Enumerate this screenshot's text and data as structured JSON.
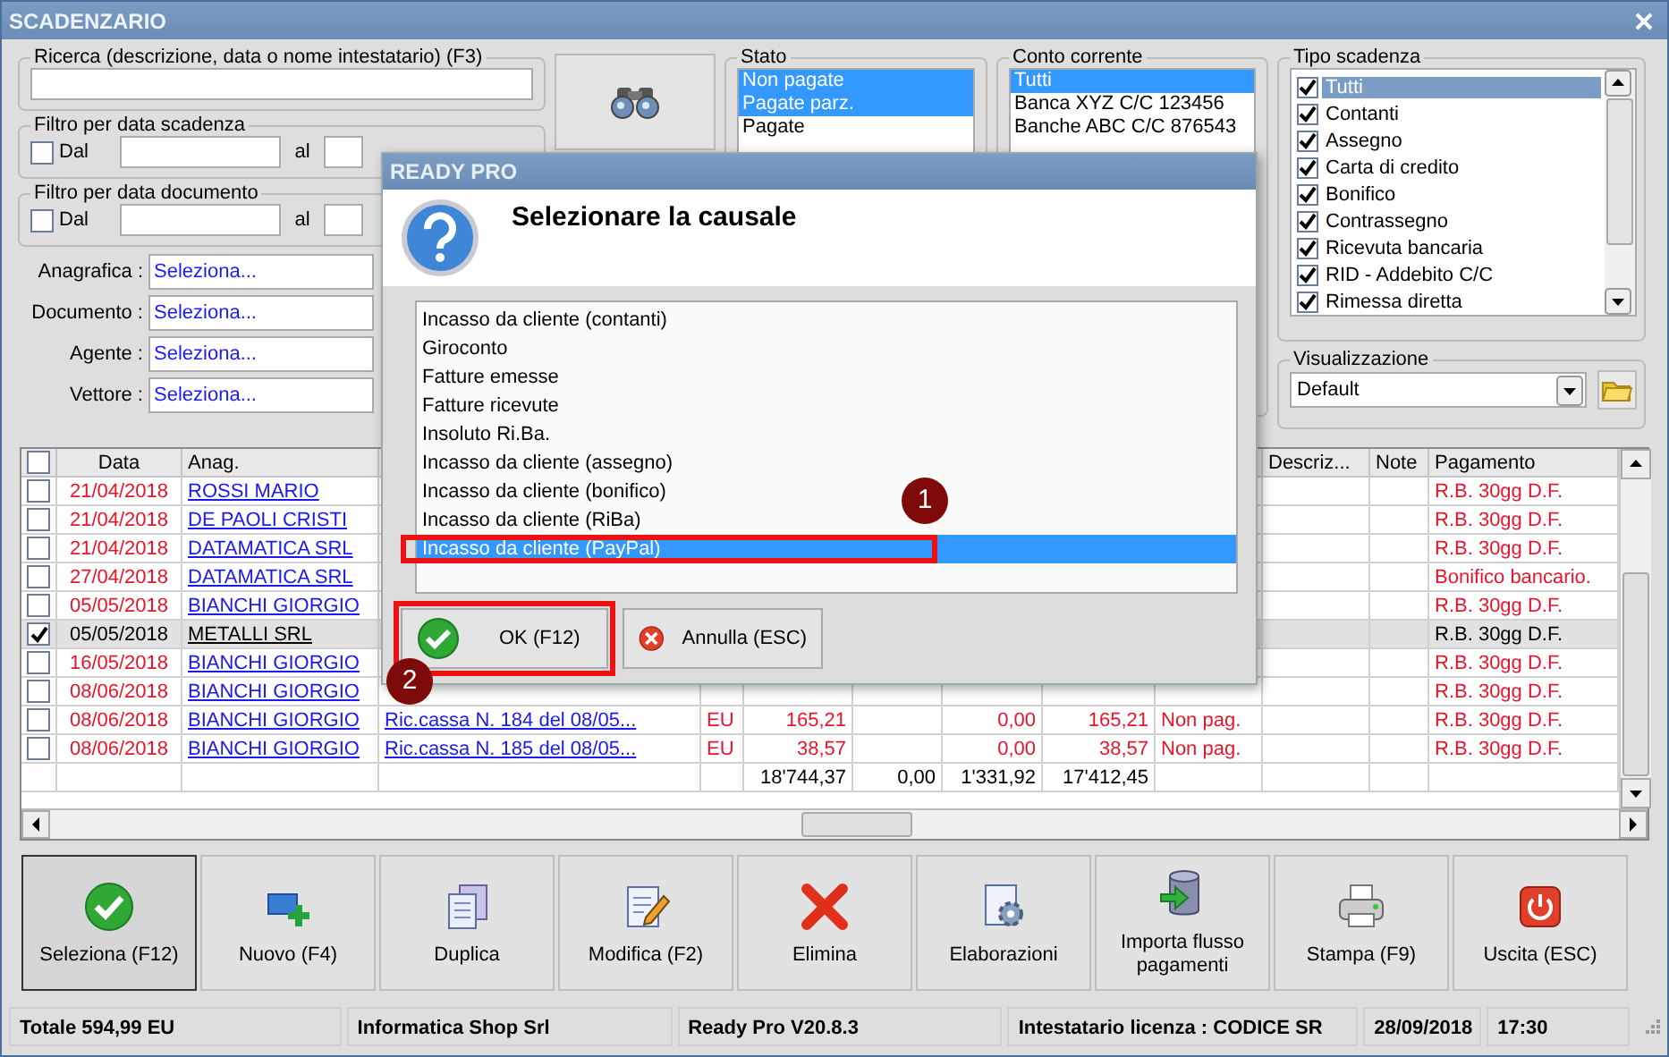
{
  "window": {
    "title": "SCADENZARIO"
  },
  "search": {
    "label": "Ricerca (descrizione, data o nome intestatario) (F3)"
  },
  "date_filters": [
    {
      "label": "Filtro per data scadenza",
      "from_label": "Dal",
      "to_label": "al",
      "checked": false
    },
    {
      "label": "Filtro per data documento",
      "from_label": "Dal",
      "to_label": "al",
      "checked": false
    }
  ],
  "lookups": [
    {
      "label": "Anagrafica :",
      "value": "Seleziona..."
    },
    {
      "label": "Documento :",
      "value": "Seleziona..."
    },
    {
      "label": "Agente :",
      "value": "Seleziona..."
    },
    {
      "label": "Vettore :",
      "value": "Seleziona..."
    }
  ],
  "stato": {
    "label": "Stato",
    "items": [
      {
        "label": "Non pagate",
        "selected": true
      },
      {
        "label": "Pagate parz.",
        "selected": true
      },
      {
        "label": "Pagate",
        "selected": false
      }
    ]
  },
  "conto": {
    "label": "Conto corrente",
    "items": [
      {
        "label": "Tutti",
        "selected": true
      },
      {
        "label": "Banca XYZ C/C 123456",
        "selected": false
      },
      {
        "label": "Banche ABC C/C 876543",
        "selected": false
      }
    ]
  },
  "tipo": {
    "label": "Tipo scadenza",
    "items": [
      {
        "label": "Tutti",
        "checked": true,
        "selected": true
      },
      {
        "label": "Contanti",
        "checked": true,
        "selected": false
      },
      {
        "label": "Assegno",
        "checked": true,
        "selected": false
      },
      {
        "label": "Carta di credito",
        "checked": true,
        "selected": false
      },
      {
        "label": "Bonifico",
        "checked": true,
        "selected": false
      },
      {
        "label": "Contrassegno",
        "checked": true,
        "selected": false
      },
      {
        "label": "Ricevuta bancaria",
        "checked": true,
        "selected": false
      },
      {
        "label": "RID - Addebito C/C",
        "checked": true,
        "selected": false
      },
      {
        "label": "Rimessa diretta",
        "checked": true,
        "selected": false
      }
    ]
  },
  "view": {
    "label": "Visualizzazione",
    "value": "Default"
  },
  "table": {
    "header_checked": false,
    "headers": {
      "date": "Data",
      "name": "Anag.",
      "description": "Descriz...",
      "note": "Note",
      "payment": "Pagamento"
    },
    "rows": [
      {
        "checked": false,
        "selected": false,
        "overdue": true,
        "date": "21/04/2018",
        "name": "ROSSI MARIO",
        "payment": "R.B. 30gg D.F."
      },
      {
        "checked": false,
        "selected": false,
        "overdue": true,
        "date": "21/04/2018",
        "name": "DE PAOLI CRISTI",
        "payment": "R.B. 30gg D.F."
      },
      {
        "checked": false,
        "selected": false,
        "overdue": true,
        "date": "21/04/2018",
        "name": "DATAMATICA SRL",
        "payment": "R.B. 30gg D.F."
      },
      {
        "checked": false,
        "selected": false,
        "overdue": true,
        "date": "27/04/2018",
        "name": "DATAMATICA SRL",
        "payment": "Bonifico bancario."
      },
      {
        "checked": false,
        "selected": false,
        "overdue": true,
        "date": "05/05/2018",
        "name": "BIANCHI GIORGIO",
        "payment": "R.B. 30gg D.F."
      },
      {
        "checked": true,
        "selected": true,
        "overdue": false,
        "date": "05/05/2018",
        "name": "METALLI SRL",
        "payment": "R.B. 30gg D.F."
      },
      {
        "checked": false,
        "selected": false,
        "overdue": true,
        "date": "16/05/2018",
        "name": "BIANCHI GIORGIO",
        "payment": "R.B. 30gg D.F."
      },
      {
        "checked": false,
        "selected": false,
        "overdue": true,
        "date": "08/06/2018",
        "name": "BIANCHI GIORGIO",
        "payment": "R.B. 30gg D.F."
      },
      {
        "checked": false,
        "selected": false,
        "overdue": true,
        "date": "08/06/2018",
        "name": "BIANCHI GIORGIO",
        "column_4": "Ric.cassa N. 184 del 08/05...",
        "column_5": "EU",
        "column_6": "165,21",
        "column_8": "0,00",
        "column_9": "165,21",
        "column_10": "Non pag.",
        "payment": "R.B. 30gg D.F."
      },
      {
        "checked": false,
        "selected": false,
        "overdue": true,
        "date": "08/06/2018",
        "name": "BIANCHI GIORGIO",
        "column_4": "Ric.cassa N. 185 del 08/05...",
        "column_5": "EU",
        "column_6": "38,57",
        "column_8": "0,00",
        "column_9": "38,57",
        "column_10": "Non pag.",
        "payment": "R.B. 30gg D.F."
      }
    ],
    "totals": {
      "column_6": "18'744,37",
      "column_7": "0,00",
      "column_8": "1'331,92",
      "column_9": "17'412,45"
    }
  },
  "toolbar": [
    {
      "label": "Seleziona (F12)",
      "kind": "select",
      "selected": true
    },
    {
      "label": "Nuovo (F4)",
      "kind": "new",
      "selected": false
    },
    {
      "label": "Duplica",
      "kind": "duplicate",
      "selected": false
    },
    {
      "label": "Modifica (F2)",
      "kind": "edit",
      "selected": false
    },
    {
      "label": "Elimina",
      "kind": "delete",
      "selected": false
    },
    {
      "label": "Elaborazioni",
      "kind": "process",
      "selected": false
    },
    {
      "label": "Importa flusso pagamenti",
      "kind": "import",
      "selected": false
    },
    {
      "label": "Stampa (F9)",
      "kind": "print",
      "selected": false
    },
    {
      "label": "Uscita (ESC)",
      "kind": "exit",
      "selected": false
    }
  ],
  "status_bar": [
    "Totale 594,99 EU",
    "Informatica Shop Srl",
    "Ready Pro V20.8.3",
    "Intestatario licenza : CODICE SR",
    "28/09/2018",
    "17:30"
  ],
  "dialog": {
    "title": "READY PRO",
    "heading": "Selezionare la causale",
    "items": [
      {
        "label": "Incasso da cliente (contanti)",
        "selected": false
      },
      {
        "label": "Giroconto",
        "selected": false
      },
      {
        "label": "Fatture emesse",
        "selected": false
      },
      {
        "label": "Fatture ricevute",
        "selected": false
      },
      {
        "label": "Insoluto Ri.Ba.",
        "selected": false
      },
      {
        "label": "Incasso da cliente (assegno)",
        "selected": false
      },
      {
        "label": "Incasso da cliente (bonifico)",
        "selected": false
      },
      {
        "label": "Incasso da cliente (RiBa)",
        "selected": false
      },
      {
        "label": "Incasso da cliente (PayPal)",
        "selected": true,
        "callout": "1"
      }
    ],
    "buttons": [
      {
        "label": "OK (F12)",
        "kind": "ok",
        "callout": "2"
      },
      {
        "label": "Annulla (ESC)",
        "kind": "cancel"
      }
    ]
  }
}
